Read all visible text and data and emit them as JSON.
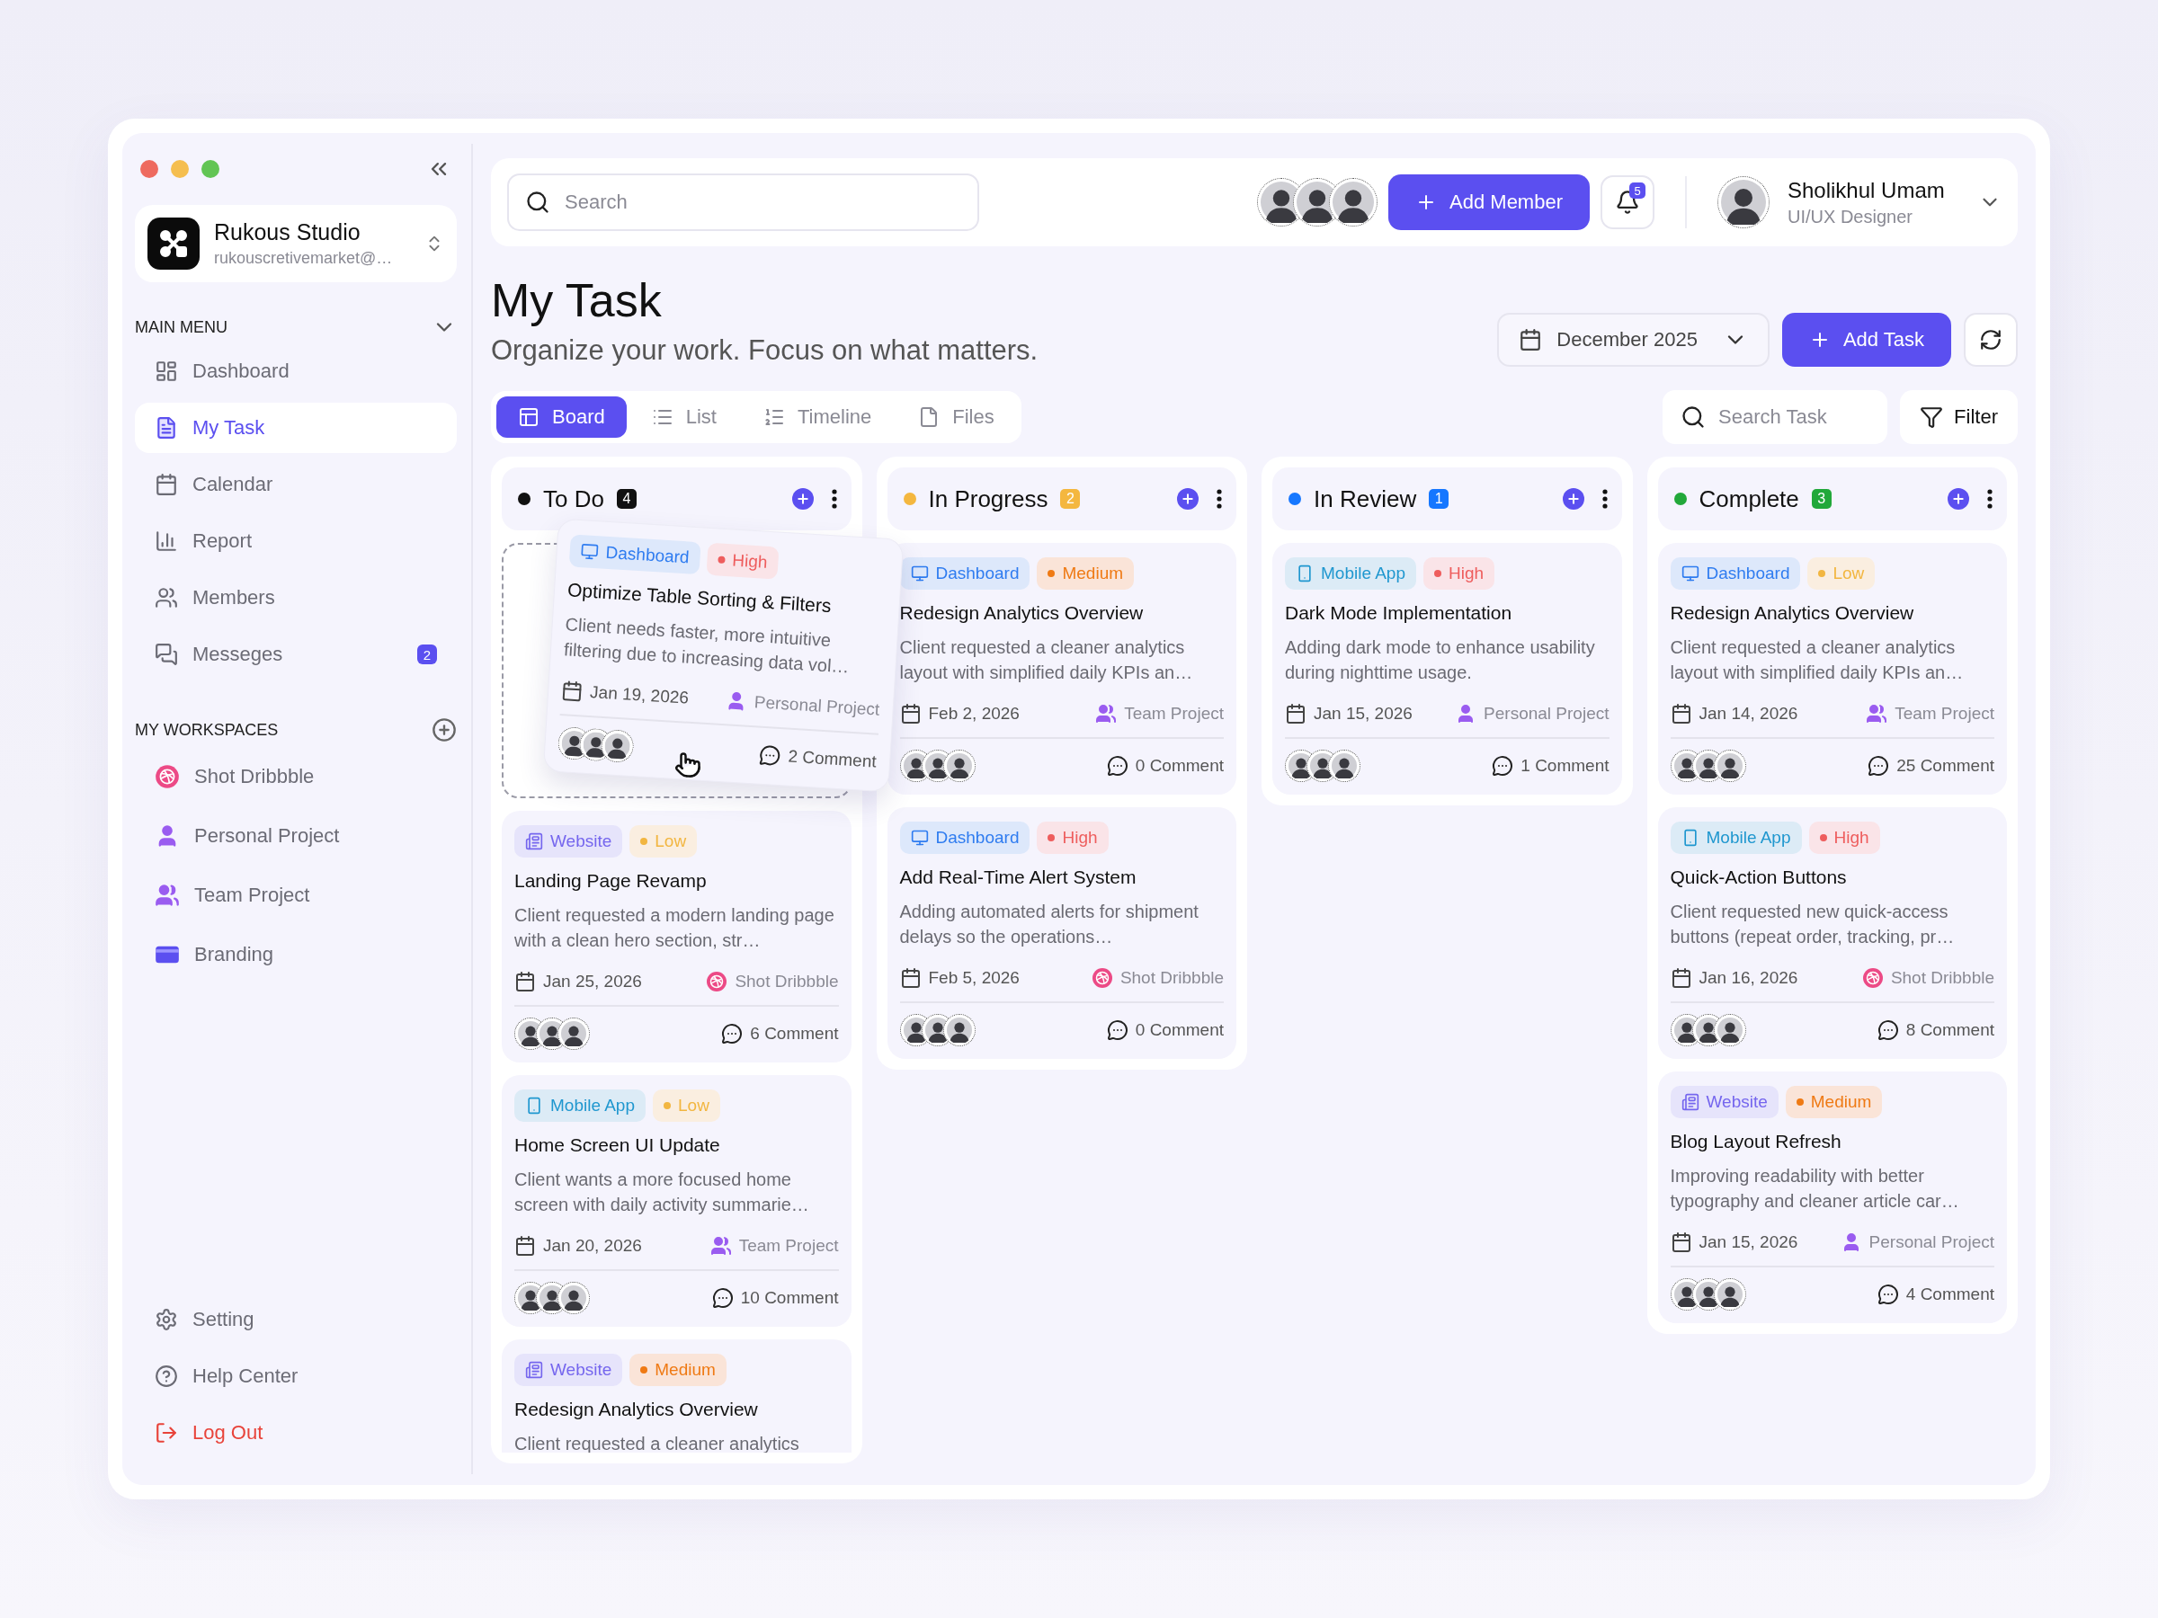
{
  "sidebar": {
    "workspace": {
      "name": "Rukous Studio",
      "email": "rukouscretivemarket@…"
    },
    "main_menu": {
      "title": "MAIN MENU",
      "expanded": true,
      "items": [
        {
          "label": "Dashboard",
          "kind": "dashboard",
          "selected": false
        },
        {
          "label": "My Task",
          "kind": "task",
          "selected": true
        },
        {
          "label": "Calendar",
          "kind": "calendar",
          "selected": false
        },
        {
          "label": "Report",
          "kind": "report",
          "selected": false
        },
        {
          "label": "Members",
          "kind": "members",
          "selected": false
        },
        {
          "label": "Messeges",
          "kind": "messages",
          "selected": false,
          "badge": "2"
        }
      ]
    },
    "workspaces": {
      "title": "MY WORKSPACES",
      "items": [
        {
          "label": "Shot Dribbble",
          "kind": "dribbble"
        },
        {
          "label": "Personal Project",
          "kind": "personal"
        },
        {
          "label": "Team Project",
          "kind": "team"
        },
        {
          "label": "Branding",
          "kind": "branding"
        }
      ]
    },
    "bottom": [
      {
        "label": "Setting",
        "kind": "setting"
      },
      {
        "label": "Help Center",
        "kind": "help"
      },
      {
        "label": "Log Out",
        "kind": "logout"
      }
    ]
  },
  "header": {
    "search": {
      "placeholder": "Search"
    },
    "add_member": "Add Member",
    "notifications": "5",
    "user": {
      "name": "Sholikhul Umam",
      "role": "UI/UX Designer"
    }
  },
  "page": {
    "title": "My Task",
    "subtitle": "Organize your work. Focus on what matters.",
    "month": "December 2025",
    "add_task": "Add Task"
  },
  "views": {
    "tabs": [
      {
        "label": "Board",
        "kind": "board",
        "selected": true
      },
      {
        "label": "List",
        "kind": "list",
        "selected": false
      },
      {
        "label": "Timeline",
        "kind": "timeline",
        "selected": false
      },
      {
        "label": "Files",
        "kind": "files",
        "selected": false
      }
    ],
    "search": {
      "placeholder": "Search Task"
    },
    "filter": "Filter"
  },
  "columns": [
    {
      "title": "To Do",
      "color": "#111111",
      "count": "4",
      "cards": [
        {
          "dragging": true,
          "category": {
            "label": "Dashboard",
            "kind": "dashboard"
          },
          "priority": {
            "label": "High",
            "kind": "high"
          },
          "title": "Optimize Table Sorting & Filters",
          "description": "Client needs faster, more intuitive filtering due to increasing data vol…",
          "date": "Jan 19, 2026",
          "project": {
            "label": "Personal Project",
            "kind": "personal"
          },
          "comments": "2 Comment"
        },
        {
          "dragging": false,
          "category": {
            "label": "Website",
            "kind": "website"
          },
          "priority": {
            "label": "Low",
            "kind": "low"
          },
          "title": "Landing Page Revamp",
          "description": "Client requested a modern landing page with a clean hero section, str…",
          "date": "Jan 25, 2026",
          "project": {
            "label": "Shot Dribbble",
            "kind": "dribbble"
          },
          "comments": "6 Comment"
        },
        {
          "dragging": false,
          "category": {
            "label": "Mobile App",
            "kind": "mobile"
          },
          "priority": {
            "label": "Low",
            "kind": "low"
          },
          "title": "Home Screen UI Update",
          "description": "Client wants a more focused home screen with daily activity summarie…",
          "date": "Jan 20, 2026",
          "project": {
            "label": "Team Project",
            "kind": "team"
          },
          "comments": "10 Comment"
        },
        {
          "dragging": false,
          "category": {
            "label": "Website",
            "kind": "website"
          },
          "priority": {
            "label": "Medium",
            "kind": "medium"
          },
          "title": "Redesign Analytics Overview",
          "description": "Client requested a cleaner analytics"
        }
      ]
    },
    {
      "title": "In Progress",
      "color": "#f4b73f",
      "count": "2",
      "cards": [
        {
          "dragging": false,
          "category": {
            "label": "Dashboard",
            "kind": "dashboard"
          },
          "priority": {
            "label": "Medium",
            "kind": "medium"
          },
          "title": "Redesign Analytics Overview",
          "description": "Client requested a cleaner analytics layout with simplified daily KPIs an…",
          "date": "Feb 2, 2026",
          "project": {
            "label": "Team Project",
            "kind": "team"
          },
          "comments": "0 Comment"
        },
        {
          "dragging": false,
          "category": {
            "label": "Dashboard",
            "kind": "dashboard"
          },
          "priority": {
            "label": "High",
            "kind": "high"
          },
          "title": "Add Real-Time Alert System",
          "description": "Adding automated alerts for shipment delays so the operations…",
          "date": "Feb 5, 2026",
          "project": {
            "label": "Shot Dribbble",
            "kind": "dribbble"
          },
          "comments": "0 Comment"
        }
      ]
    },
    {
      "title": "In Review",
      "color": "#1677ff",
      "count": "1",
      "cards": [
        {
          "dragging": false,
          "category": {
            "label": "Mobile App",
            "kind": "mobile"
          },
          "priority": {
            "label": "High",
            "kind": "high"
          },
          "title": "Dark Mode Implementation",
          "description": "Adding dark mode to enhance usability during nighttime usage.",
          "date": "Jan 15, 2026",
          "project": {
            "label": "Personal Project",
            "kind": "personal"
          },
          "comments": "1 Comment"
        }
      ]
    },
    {
      "title": "Complete",
      "color": "#22a83a",
      "count": "3",
      "cards": [
        {
          "dragging": false,
          "category": {
            "label": "Dashboard",
            "kind": "dashboard"
          },
          "priority": {
            "label": "Low",
            "kind": "low"
          },
          "title": "Redesign Analytics Overview",
          "description": "Client requested a cleaner analytics layout with simplified daily KPIs an…",
          "date": "Jan 14, 2026",
          "project": {
            "label": "Team Project",
            "kind": "team"
          },
          "comments": "25 Comment"
        },
        {
          "dragging": false,
          "category": {
            "label": "Mobile App",
            "kind": "mobile"
          },
          "priority": {
            "label": "High",
            "kind": "high"
          },
          "title": "Quick-Action Buttons",
          "description": "Client requested new quick-access buttons (repeat order, tracking, pr…",
          "date": "Jan 16, 2026",
          "project": {
            "label": "Shot Dribbble",
            "kind": "dribbble"
          },
          "comments": "8 Comment"
        },
        {
          "dragging": false,
          "category": {
            "label": "Website",
            "kind": "website"
          },
          "priority": {
            "label": "Medium",
            "kind": "medium"
          },
          "title": "Blog Layout Refresh",
          "description": "Improving readability with better typography and cleaner article car…",
          "date": "Jan 15, 2026",
          "project": {
            "label": "Personal Project",
            "kind": "personal"
          },
          "comments": "4 Comment"
        }
      ]
    }
  ]
}
